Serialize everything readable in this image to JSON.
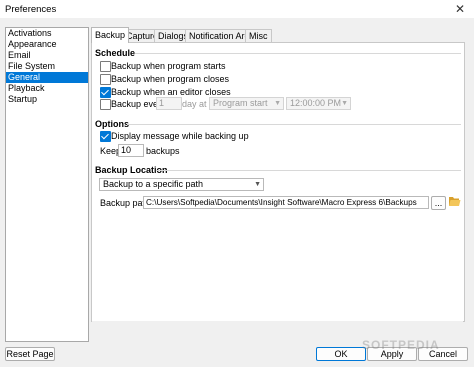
{
  "window": {
    "title": "Preferences"
  },
  "categories": [
    "Activations",
    "Appearance",
    "Email",
    "File System",
    "General",
    "Playback",
    "Startup"
  ],
  "tabs": [
    "Backup",
    "Capture",
    "Dialogs",
    "Notification Area",
    "Misc"
  ],
  "schedule": {
    "header": "Schedule",
    "program_starts": "Backup when program starts",
    "program_closes": "Backup when program closes",
    "editor_closes": "Backup when an editor closes",
    "every": "Backup every",
    "every_value": "1",
    "every_unit": "day at",
    "at_select": "Program start",
    "time_value": "12:00:00 PM"
  },
  "options": {
    "header": "Options",
    "display_message": "Display message while backing up",
    "keep_label": "Keep",
    "keep_value": "10",
    "keep_unit": "backups"
  },
  "location": {
    "header": "Backup Location",
    "mode": "Backup to a specific path",
    "path_label": "Backup path:",
    "path_value": "C:\\Users\\Softpedia\\Documents\\Insight Software\\Macro Express 6\\Backups",
    "browse": "..."
  },
  "footer": {
    "reset": "Reset Page",
    "ok": "OK",
    "apply": "Apply",
    "cancel": "Cancel"
  },
  "watermark": "SOFTPEDIA",
  "colors": {
    "accent": "#0078d7",
    "folder": "#e8b33c"
  }
}
